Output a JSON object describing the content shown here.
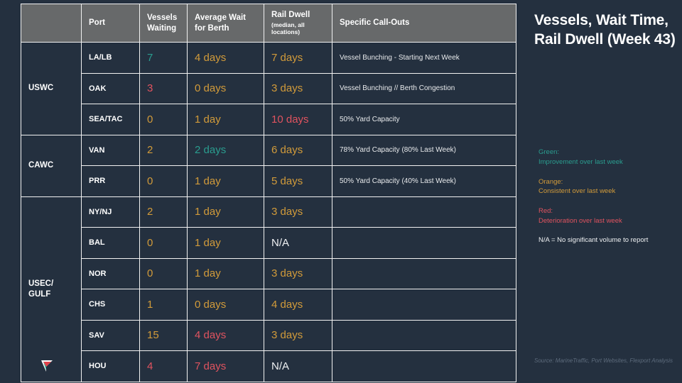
{
  "side": {
    "title": "Vessels, Wait Time, Rail Dwell (Week 43)",
    "legend": [
      {
        "label": "Green:",
        "desc": "Improvement over last week",
        "color": "#2a9d8f"
      },
      {
        "label": "Orange:",
        "desc": "Consistent over last week",
        "color": "#d29b3a"
      },
      {
        "label": "Red:",
        "desc": "Deterioration over last week",
        "color": "#e0535f"
      }
    ],
    "na_note": "N/A = No significant volume to report",
    "source": "Source: MarineTraffic, Port Websites, Flexport Analysis"
  },
  "table": {
    "headers": {
      "group": "",
      "port": "Port",
      "vessels_waiting": "Vessels Waiting",
      "average_wait": "Average Wait for Berth",
      "rail_dwell": "Rail Dwell",
      "rail_dwell_sub": "(median, all locations)",
      "callouts": "Specific Call-Outs"
    },
    "groups": [
      {
        "name": "USWC",
        "rows": [
          {
            "port": "LA/LB",
            "vessels": "7",
            "vessels_color": "green",
            "wait": "4 days",
            "wait_color": "orange",
            "rail": "7 days",
            "rail_color": "orange",
            "callout": "Vessel Bunching - Starting Next Week"
          },
          {
            "port": "OAK",
            "vessels": "3",
            "vessels_color": "red",
            "wait": "0 days",
            "wait_color": "orange",
            "rail": "3 days",
            "rail_color": "orange",
            "callout": "Vessel Bunching // Berth Congestion"
          },
          {
            "port": "SEA/TAC",
            "vessels": "0",
            "vessels_color": "orange",
            "wait": "1 day",
            "wait_color": "orange",
            "rail": "10 days",
            "rail_color": "red",
            "callout": "50% Yard Capacity"
          }
        ]
      },
      {
        "name": "CAWC",
        "rows": [
          {
            "port": "VAN",
            "vessels": "2",
            "vessels_color": "orange",
            "wait": "2 days",
            "wait_color": "green",
            "rail": "6 days",
            "rail_color": "orange",
            "callout": "78% Yard Capacity (80% Last Week)"
          },
          {
            "port": "PRR",
            "vessels": "0",
            "vessels_color": "orange",
            "wait": "1 day",
            "wait_color": "orange",
            "rail": "5 days",
            "rail_color": "orange",
            "callout": "50% Yard Capacity (40% Last Week)"
          }
        ]
      },
      {
        "name": "USEC/ GULF",
        "rows": [
          {
            "port": "NY/NJ",
            "vessels": "2",
            "vessels_color": "orange",
            "wait": "1 day",
            "wait_color": "orange",
            "rail": "3 days",
            "rail_color": "orange",
            "callout": ""
          },
          {
            "port": "BAL",
            "vessels": "0",
            "vessels_color": "orange",
            "wait": "1 day",
            "wait_color": "orange",
            "rail": "N/A",
            "rail_color": "white",
            "callout": ""
          },
          {
            "port": "NOR",
            "vessels": "0",
            "vessels_color": "orange",
            "wait": "1 day",
            "wait_color": "orange",
            "rail": "3 days",
            "rail_color": "orange",
            "callout": ""
          },
          {
            "port": "CHS",
            "vessels": "1",
            "vessels_color": "orange",
            "wait": "0 days",
            "wait_color": "orange",
            "rail": "4 days",
            "rail_color": "orange",
            "callout": ""
          },
          {
            "port": "SAV",
            "vessels": "15",
            "vessels_color": "orange",
            "wait": "4 days",
            "wait_color": "red",
            "rail": "3 days",
            "rail_color": "orange",
            "callout": ""
          },
          {
            "port": "HOU",
            "vessels": "4",
            "vessels_color": "red",
            "wait": "7 days",
            "wait_color": "red",
            "rail": "N/A",
            "rail_color": "white",
            "callout": ""
          }
        ]
      }
    ]
  }
}
